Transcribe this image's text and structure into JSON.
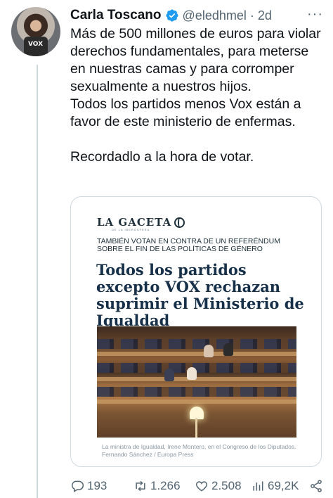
{
  "author": {
    "name": "Carla Toscano",
    "handle": "@eledhmel",
    "separator": "·",
    "time": "2d",
    "avatar_badge_text": "VOX"
  },
  "tweet": {
    "paragraphs": [
      "Más de 500 millones de euros para violar derechos fundamentales, para meterse en nuestras camas y para corromper sexualmente a nuestros hijos.",
      "Todos los partidos menos Vox están a favor de este ministerio de enfermas.",
      "Recordadlo a la hora de votar."
    ]
  },
  "card": {
    "logo": "LA GACETA",
    "logo_sub": "DE LA IBEROSFERA",
    "kicker": "TAMBIÉN VOTAN EN CONTRA DE UN REFERÉNDUM SOBRE EL FIN DE LAS POLÍTICAS DE GÉNERO",
    "headline": "Todos los partidos excepto VOX rechazan suprimir el Ministerio de Igualdad",
    "caption": "La ministra de Igualdad, Irene Montero, en el Congreso de los Diputados. Fernando Sánchez / Europa Press"
  },
  "actions": {
    "replies": "193",
    "retweets": "1.266",
    "likes": "2.508",
    "views": "69,2K"
  },
  "icons": {
    "verified": "verified-badge-icon",
    "more": "more-icon",
    "reply": "reply-icon",
    "retweet": "retweet-icon",
    "like": "heart-icon",
    "views": "views-icon",
    "share": "share-icon"
  },
  "colors": {
    "verified": "#1d9bf0",
    "muted_text": "#536471",
    "border": "#cfd9de",
    "headline": "#17304a"
  }
}
